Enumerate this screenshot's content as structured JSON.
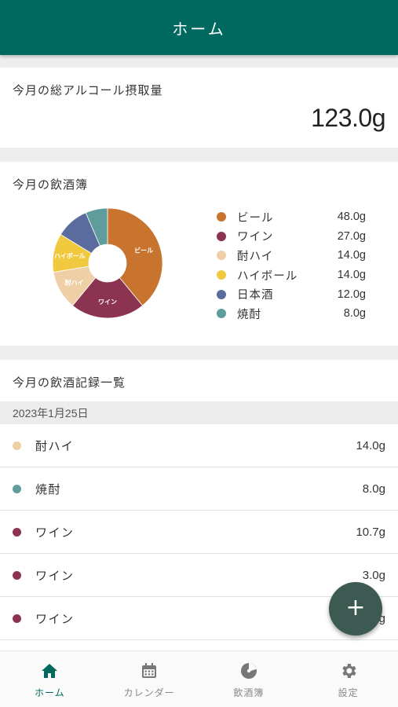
{
  "app_bar": {
    "title": "ホーム"
  },
  "total_card": {
    "title": "今月の総アルコール摂取量",
    "value": "123.0g"
  },
  "chart_card": {
    "title": "今月の飲酒簿",
    "chart_data": {
      "type": "pie",
      "donut": true,
      "categories": [
        "ビール",
        "ワイン",
        "酎ハイ",
        "ハイボール",
        "日本酒",
        "焼酎"
      ],
      "values": [
        48.0,
        27.0,
        14.0,
        14.0,
        12.0,
        8.0
      ],
      "unit": "g",
      "colors": [
        "#c8742e",
        "#8b3350",
        "#efcfa5",
        "#f1c93e",
        "#5a6c9e",
        "#5f9c9c"
      ],
      "slice_labels": [
        "ビール",
        "ワイン",
        "酎ハイ",
        "ハイボール",
        "",
        ""
      ],
      "legend_position": "right"
    },
    "legend": [
      {
        "label": "ビール",
        "value": "48.0g",
        "color": "#c8742e"
      },
      {
        "label": "ワイン",
        "value": "27.0g",
        "color": "#8b3350"
      },
      {
        "label": "酎ハイ",
        "value": "14.0g",
        "color": "#efcfa5"
      },
      {
        "label": "ハイボール",
        "value": "14.0g",
        "color": "#f1c93e"
      },
      {
        "label": "日本酒",
        "value": "12.0g",
        "color": "#5a6c9e"
      },
      {
        "label": "焼酎",
        "value": "8.0g",
        "color": "#5f9c9c"
      }
    ]
  },
  "records_card": {
    "title": "今月の飲酒記録一覧",
    "date": "2023年1月25日",
    "records": [
      {
        "name": "酎ハイ",
        "amount": "14.0g",
        "color": "#efcfa5"
      },
      {
        "name": "焼酎",
        "amount": "8.0g",
        "color": "#5f9c9c"
      },
      {
        "name": "ワイン",
        "amount": "10.7g",
        "color": "#8b3350"
      },
      {
        "name": "ワイン",
        "amount": "3.0g",
        "color": "#8b3350"
      },
      {
        "name": "ワイン",
        "amount": "3.0g",
        "color": "#8b3350"
      }
    ]
  },
  "fab": {
    "label": "+",
    "icon": "plus-icon"
  },
  "bottom_nav": {
    "items": [
      {
        "label": "ホーム",
        "icon": "home-icon",
        "active": true
      },
      {
        "label": "カレンダー",
        "icon": "calendar-icon",
        "active": false
      },
      {
        "label": "飲酒簿",
        "icon": "pie-chart-icon",
        "active": false
      },
      {
        "label": "設定",
        "icon": "gear-icon",
        "active": false
      }
    ]
  },
  "colors": {
    "primary": "#00695f",
    "fab": "#3d5a52"
  }
}
